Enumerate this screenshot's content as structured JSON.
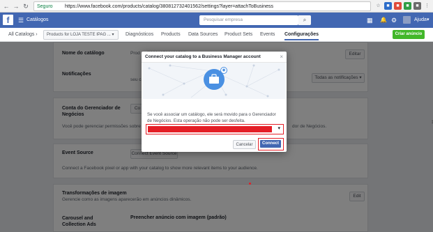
{
  "browser": {
    "secure_label": "Seguro",
    "url": "https://www.facebook.com/products/catalog/380812732401562/settings?layer=attachToBusiness"
  },
  "fbbar": {
    "section": "Catálogos",
    "search_placeholder": "Pesquisar empresa",
    "help": "Ajuda"
  },
  "subnav": {
    "all_catalogs": "All Catalogs",
    "catalog_selector": "Products for LOJA TESTE IPAG ...",
    "tabs": [
      "Diagnósticos",
      "Products",
      "Data Sources",
      "Product Sets",
      "Events",
      "Configurações"
    ],
    "active_tab": "Configurações",
    "create_button": "Criar anúncio"
  },
  "settings": {
    "catalog_name_label": "Nome do catálogo",
    "catalog_name_value": "Prod ... (380812732401562)",
    "edit_label": "Editar",
    "notifications_label": "Notificações",
    "notifications_value": "seu ca...",
    "notifications_dropdown": "Todas as notificações",
    "bm_account_label": "Conta do Gerenciador de Negócios",
    "bm_button": "Co",
    "bm_desc": "Você pode gerenciar permissões sobre",
    "bm_desc_tail": "dor de Negócios.",
    "event_source_label": "Event Source",
    "event_source_button": "Connect Event Source",
    "event_source_desc": "Connect a Facebook pixel or app with your catalog to show more relevant items to your audience.",
    "image_transform_label": "Transformações de imagem",
    "image_transform_desc": "Gerencie como as imagens aparecerão em anúncios dinâmicos.",
    "image_edit": "Edit",
    "carousel_label": "Carousel and Collection Ads",
    "carousel_value": "Preencher anúncio com imagem (padrão)"
  },
  "modal": {
    "title": "Connect your catalog to a Business Manager account",
    "close": "×",
    "body": "Se você associar um catálogo, ele será movido para o Gerenciador de Negócios. Esta operação não pode ser desfeita.",
    "cancel": "Cancelar",
    "connect": "Connect"
  },
  "colors": {
    "fb_blue": "#4267b2",
    "highlight_red": "#e41e26",
    "create_green": "#42b72a"
  }
}
